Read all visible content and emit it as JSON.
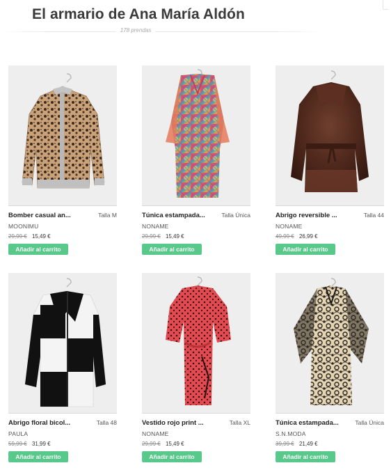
{
  "header": {
    "title": "El armario de Ana María Aldón",
    "item_count": "178 prendas"
  },
  "products": [
    {
      "name": "Bomber casual an...",
      "size": "Talla M",
      "brand": "MOONIMU",
      "old_price": "29,99 €",
      "price": "15,49 €",
      "button": "Añadir al carrito",
      "image": "leopard-print-bomber-jacket"
    },
    {
      "name": "Túnica estampada...",
      "size": "Talla Única",
      "brand": "NONAME",
      "old_price": "29,99 €",
      "price": "15,49 €",
      "button": "Añadir al carrito",
      "image": "printed-tunic-dress"
    },
    {
      "name": "Abrigo reversible ...",
      "size": "Talla 44",
      "brand": "NONAME",
      "old_price": "49,99 €",
      "price": "26,99 €",
      "button": "Añadir al carrito",
      "image": "brown-fur-coat"
    },
    {
      "name": "Abrigo floral bicol...",
      "size": "Talla 48",
      "brand": "PAULA",
      "old_price": "59,99 €",
      "price": "31,99 €",
      "button": "Añadir al carrito",
      "image": "black-white-block-coat"
    },
    {
      "name": "Vestido rojo print ...",
      "size": "Talla XL",
      "brand": "NONAME",
      "old_price": "29,99 €",
      "price": "15,49 €",
      "button": "Añadir al carrito",
      "image": "red-polka-dot-dress"
    },
    {
      "name": "Túnica estampada...",
      "size": "Talla Única",
      "brand": "S.N.MODA",
      "old_price": "39,99 €",
      "price": "21,49 €",
      "button": "Añadir al carrito",
      "image": "paisley-print-tunic"
    }
  ],
  "colors": {
    "button_green": "#58c98a",
    "image_background": "#eeeeee"
  }
}
